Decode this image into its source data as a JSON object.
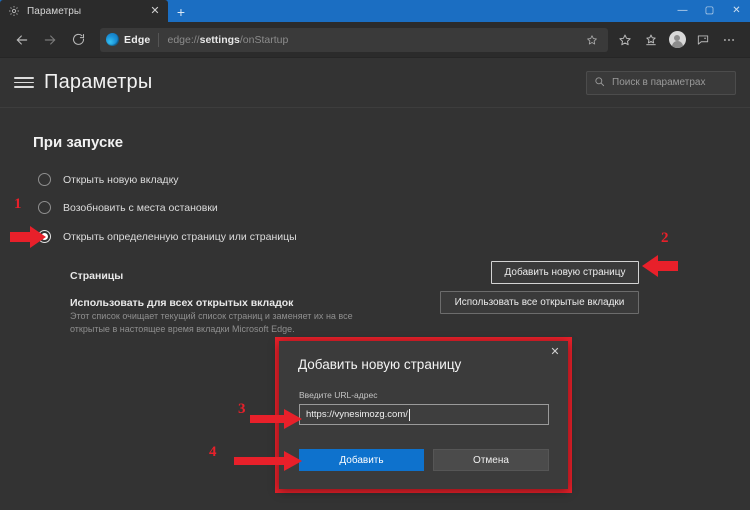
{
  "window": {
    "tab": {
      "favicon": "gear-icon",
      "title": "Параметры",
      "close_label": "✕"
    },
    "new_tab_label": "+",
    "controls": {
      "minimize": "—",
      "maximize": "▢",
      "close": "✕"
    }
  },
  "toolbar": {
    "back": "back-arrow-icon",
    "forward": "forward-arrow-icon",
    "reload": "reload-icon",
    "omnibox": {
      "brand_label": "Edge",
      "url_prefix": "edge://",
      "url_bold": "settings",
      "url_suffix": "/onStartup",
      "full_url": "edge://settings/onStartup",
      "star_icon": "favorite-star-icon"
    },
    "favorites_icon": "favorites-star-icon",
    "collections_icon": "collections-icon",
    "profile_icon": "profile-avatar-icon",
    "feedback_icon": "feedback-icon",
    "more_icon": "more-ellipsis-icon"
  },
  "settings_header": {
    "menu_icon": "hamburger-menu-icon",
    "title": "Параметры",
    "search": {
      "icon": "search-icon",
      "placeholder": "Поиск в параметрах",
      "value": ""
    }
  },
  "startup": {
    "section_title": "При запуске",
    "options": [
      {
        "label": "Открыть новую вкладку",
        "selected": false
      },
      {
        "label": "Возобновить с места остановки",
        "selected": false
      },
      {
        "label": "Открыть определенную страницу или страницы",
        "selected": true
      }
    ],
    "pages_row": {
      "label": "Страницы",
      "button": "Добавить новую страницу"
    },
    "all_tabs_row": {
      "label": "Использовать для всех открытых вкладок",
      "button": "Использовать все открытые вкладки",
      "description": "Этот список очищает текущий список страниц и заменяет их на все открытые в настоящее время вкладки Microsoft Edge."
    }
  },
  "dialog": {
    "title": "Добавить новую страницу",
    "close_label": "✕",
    "field_label": "Введите URL-адрес",
    "input_value": "https://vynesimozg.com/",
    "input_placeholder": "",
    "primary_button": "Добавить",
    "secondary_button": "Отмена"
  },
  "annotations": {
    "color": "#e8202a",
    "steps": [
      {
        "number": "1",
        "direction": "right",
        "target": "radio-open-specific-pages"
      },
      {
        "number": "2",
        "direction": "left",
        "target": "add-new-page-button"
      },
      {
        "number": "3",
        "direction": "right",
        "target": "dialog-url-input"
      },
      {
        "number": "4",
        "direction": "right",
        "target": "dialog-add-button"
      }
    ]
  },
  "colors": {
    "titlebar": "#1b6ec2",
    "toolbar": "#2b2b2b",
    "page_bg": "#333333",
    "dialog_bg": "#3b3b3b",
    "accent_blue": "#0e72cd",
    "annotation_red": "#e8202a"
  }
}
